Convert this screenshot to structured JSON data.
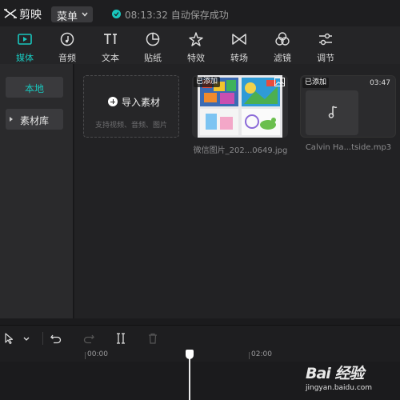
{
  "app": {
    "name": "剪映",
    "menu_label": "菜单",
    "status_time": "08:13:32",
    "status_text": "自动保存成功"
  },
  "tabs": [
    {
      "label": "媒体",
      "icon": "media-icon",
      "active": true
    },
    {
      "label": "音频",
      "icon": "audio-icon"
    },
    {
      "label": "文本",
      "icon": "text-icon"
    },
    {
      "label": "贴纸",
      "icon": "sticker-icon"
    },
    {
      "label": "特效",
      "icon": "effects-icon"
    },
    {
      "label": "转场",
      "icon": "transition-icon"
    },
    {
      "label": "滤镜",
      "icon": "filter-icon"
    },
    {
      "label": "调节",
      "icon": "adjust-icon"
    }
  ],
  "sidebar": {
    "items": [
      {
        "label": "本地",
        "active": true
      },
      {
        "label": "素材库"
      }
    ]
  },
  "media": {
    "import_label": "导入素材",
    "import_hint": "支持视频、音频、图片",
    "items": [
      {
        "badge": "已添加",
        "name": "微信图片_202...0649.jpg",
        "type": "image"
      },
      {
        "badge": "已添加",
        "name": "Calvin Ha...tside.mp3",
        "type": "audio",
        "duration": "03:47"
      }
    ]
  },
  "timeline": {
    "ticks": [
      "00:00",
      "02:00"
    ]
  },
  "watermark": {
    "logo": "Bai 经验",
    "sub": "jingyan.baidu.com"
  },
  "colors": {
    "accent": "#19c7be",
    "bg": "#1b1b1d"
  }
}
